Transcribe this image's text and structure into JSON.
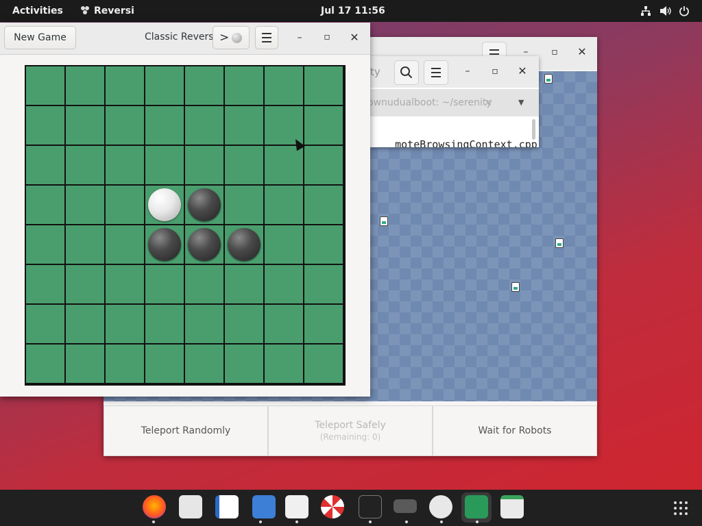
{
  "topbar": {
    "activities": "Activities",
    "app_name": "Reversi",
    "clock": "Jul 17  11:56"
  },
  "reversi": {
    "new_game": "New Game",
    "title": "Classic Reversi",
    "turn_indicator": ">",
    "board": [
      [
        "",
        "",
        "",
        "",
        "",
        "",
        "",
        ""
      ],
      [
        "",
        "",
        "",
        "",
        "",
        "",
        "",
        ""
      ],
      [
        "",
        "",
        "",
        "",
        "",
        "",
        "",
        ""
      ],
      [
        "",
        "",
        "",
        "white",
        "black",
        "",
        "",
        ""
      ],
      [
        "",
        "",
        "",
        "black",
        "black",
        "black",
        "",
        ""
      ],
      [
        "",
        "",
        "",
        "",
        "",
        "",
        "",
        ""
      ],
      [
        "",
        "",
        "",
        "",
        "",
        "",
        "",
        ""
      ],
      [
        "",
        "",
        "",
        "",
        "",
        "",
        "",
        ""
      ]
    ],
    "board_color": "#4a9e6e"
  },
  "terminal": {
    "title_fragment": "ty",
    "tab_label": "ownudualboot: ~/serenity",
    "tab_close": "×",
    "line": "moteBrowsingContext.cpp.o"
  },
  "robots": {
    "teleport_randomly": "Teleport Randomly",
    "teleport_safely": "Teleport Safely",
    "teleport_safely_sub": "(Remaining: 0)",
    "wait_for_robots": "Wait for Robots"
  },
  "dock": {
    "apps": [
      "firefox-icon",
      "files-clock-icon",
      "writer-icon",
      "text-editor-icon",
      "software-icon",
      "help-icon",
      "terminal-icon",
      "vim-icon",
      "robots-icon",
      "reversi-icon",
      "trash-icon"
    ]
  }
}
